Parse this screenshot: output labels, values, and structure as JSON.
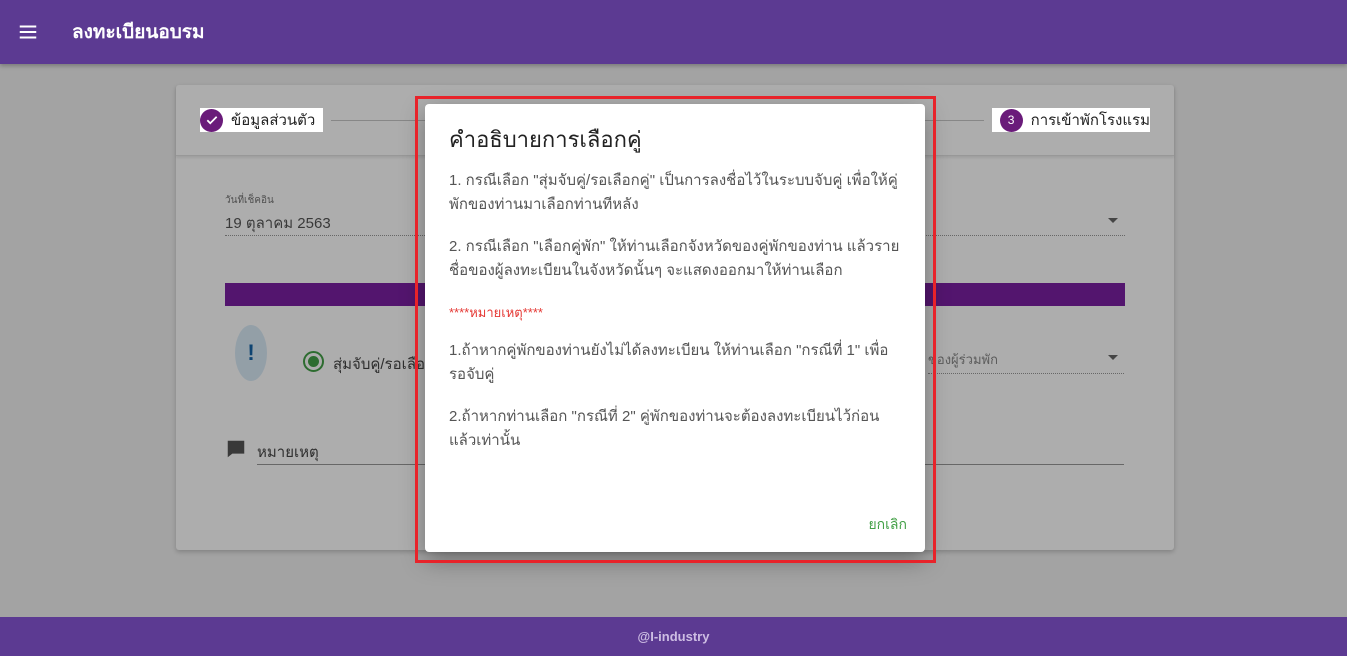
{
  "appbar": {
    "title": "ลงทะเบียนอบรม",
    "menu_icon": "menu-icon"
  },
  "stepper": {
    "steps": [
      {
        "label": "ข้อมูลส่วนตัว",
        "state": "done"
      },
      {
        "label": "การเข้าพักโรงแรม",
        "number": "3",
        "state": "active"
      }
    ]
  },
  "form": {
    "checkin_label": "วันที่เช็คอิน",
    "checkin_value": "19 ตุลาคม 2563",
    "radio_label": "สุ่มจับคู่/รอเลือ",
    "roommate_label": "ของผู้ร่วมพัก",
    "note_label": "หมายเหตุ"
  },
  "dialog": {
    "title": "คำอธิบายการเลือกคู่",
    "p1": "1. กรณีเลือก \"สุ่มจับคู่/รอเลือกคู่\" เป็นการลงชื่อไว้ในระบบจับคู่ เพื่อให้คู่พักของท่านมาเลือกท่านทีหลัง",
    "p2": "2. กรณีเลือก \"เลือกคู่พัก\" ให้ท่านเลือกจังหวัดของคู่พักของท่าน แล้วรายชื่อของผู้ลงทะเบียนในจังหวัดนั้นๆ จะแสดงออกมาให้ท่านเลือก",
    "warning": "****หมายเหตุ****",
    "n1": "1.ถ้าหากคู่พักของท่านยังไม่ได้ลงทะเบียน ให้ท่านเลือก \"กรณีที่ 1\" เพื่อรอจับคู่",
    "n2": "2.ถ้าหากท่านเลือก \"กรณีที่ 2\" คู่พักของท่านจะต้องลงทะเบียนไว้ก่อนแล้วเท่านั้น",
    "cancel_label": "ยกเลิก"
  },
  "footer": {
    "text": "@I-industry"
  },
  "colors": {
    "primary": "#5c3a92",
    "accent": "#7b1fa2",
    "success": "#43a047",
    "warning": "#e53935"
  }
}
